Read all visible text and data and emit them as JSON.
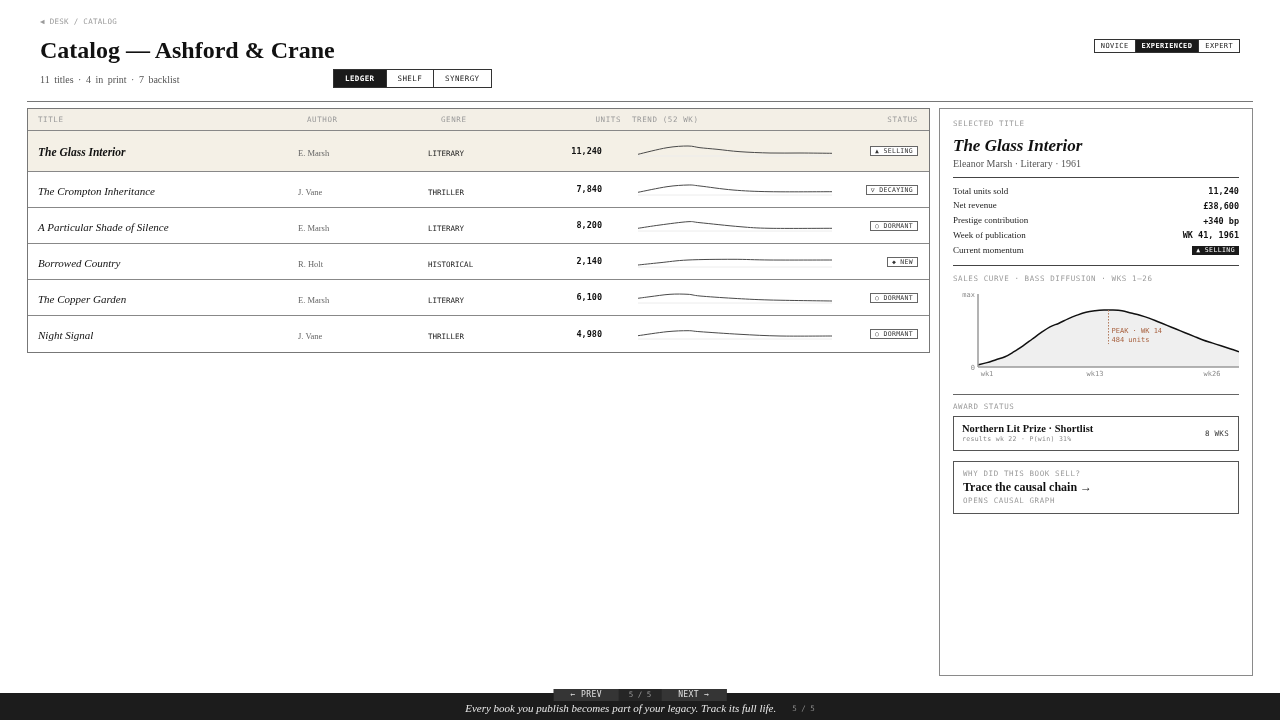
{
  "breadcrumb": "◀ DESK / CATALOG",
  "title": "Catalog — Ashford & Crane",
  "summary": "11 titles · 4 in print · 7 backlist",
  "view_tabs": [
    {
      "label": "LEDGER",
      "selected": true
    },
    {
      "label": "SHELF",
      "selected": false
    },
    {
      "label": "SYNERGY",
      "selected": false
    }
  ],
  "mode_toggle": [
    {
      "label": "NOVICE",
      "selected": false
    },
    {
      "label": "EXPERIENCED",
      "selected": true
    },
    {
      "label": "EXPERT",
      "selected": false
    }
  ],
  "table": {
    "columns": [
      "TITLE",
      "AUTHOR",
      "GENRE",
      "UNITS",
      "TREND (52 WK)",
      "STATUS"
    ],
    "rows": [
      {
        "title": "The Glass Interior",
        "author": "E. Marsh",
        "genre": "LITERARY",
        "units": "11,240",
        "status": "▲ SELLING",
        "selected": true
      },
      {
        "title": "The Crompton Inheritance",
        "author": "J. Vane",
        "genre": "THRILLER",
        "units": "7,840",
        "status": "▽ DECAYING",
        "selected": false
      },
      {
        "title": "A Particular Shade of Silence",
        "author": "E. Marsh",
        "genre": "LITERARY",
        "units": "8,200",
        "status": "○ DORMANT",
        "selected": false
      },
      {
        "title": "Borrowed Country",
        "author": "R. Holt",
        "genre": "HISTORICAL",
        "units": "2,140",
        "status": "◆ NEW",
        "selected": false
      },
      {
        "title": "The Copper Garden",
        "author": "E. Marsh",
        "genre": "LITERARY",
        "units": "6,100",
        "status": "○ DORMANT",
        "selected": false
      },
      {
        "title": "Night Signal",
        "author": "J. Vane",
        "genre": "THRILLER",
        "units": "4,980",
        "status": "○ DORMANT",
        "selected": false
      }
    ]
  },
  "detail": {
    "label": "SELECTED TITLE",
    "title": "The Glass Interior",
    "byline": "Eleanor Marsh · Literary · 1961",
    "stats": [
      {
        "label": "Total units sold",
        "value": "11,240",
        "kind": "text"
      },
      {
        "label": "Net revenue",
        "value": "£38,600",
        "kind": "text"
      },
      {
        "label": "Prestige contribution",
        "value": "+340 bp",
        "kind": "text"
      },
      {
        "label": "Week of publication",
        "value": "WK 41, 1961",
        "kind": "text"
      },
      {
        "label": "Current momentum",
        "value": "▲ SELLING",
        "kind": "badge"
      }
    ],
    "chart_label": "SALES CURVE · BASS DIFFUSION · WKS 1–26",
    "sales_chart": {
      "max_label": "max",
      "zero_label": "0",
      "week_labels": [
        "wk1",
        "wk13",
        "wk26"
      ],
      "peak_label": "PEAK · WK 14",
      "peak_units": "484 units"
    },
    "award_label": "AWARD STATUS",
    "award": {
      "title": "Northern Lit Prize · Shortlist",
      "detail": "results wk 22 · P(win) 31%",
      "duration": "8 WKS"
    },
    "cta": {
      "eyebrow": "WHY DID THIS BOOK SELL?",
      "title": "Trace the causal chain →",
      "note": "OPENS CAUSAL GRAPH"
    }
  },
  "footer": {
    "nav": {
      "prev": "← PREV",
      "counter": "5 / 5",
      "next": "NEXT →"
    },
    "caption": "Every book you publish becomes part of your legacy. Track its full life.",
    "counter": "5 / 5"
  }
}
